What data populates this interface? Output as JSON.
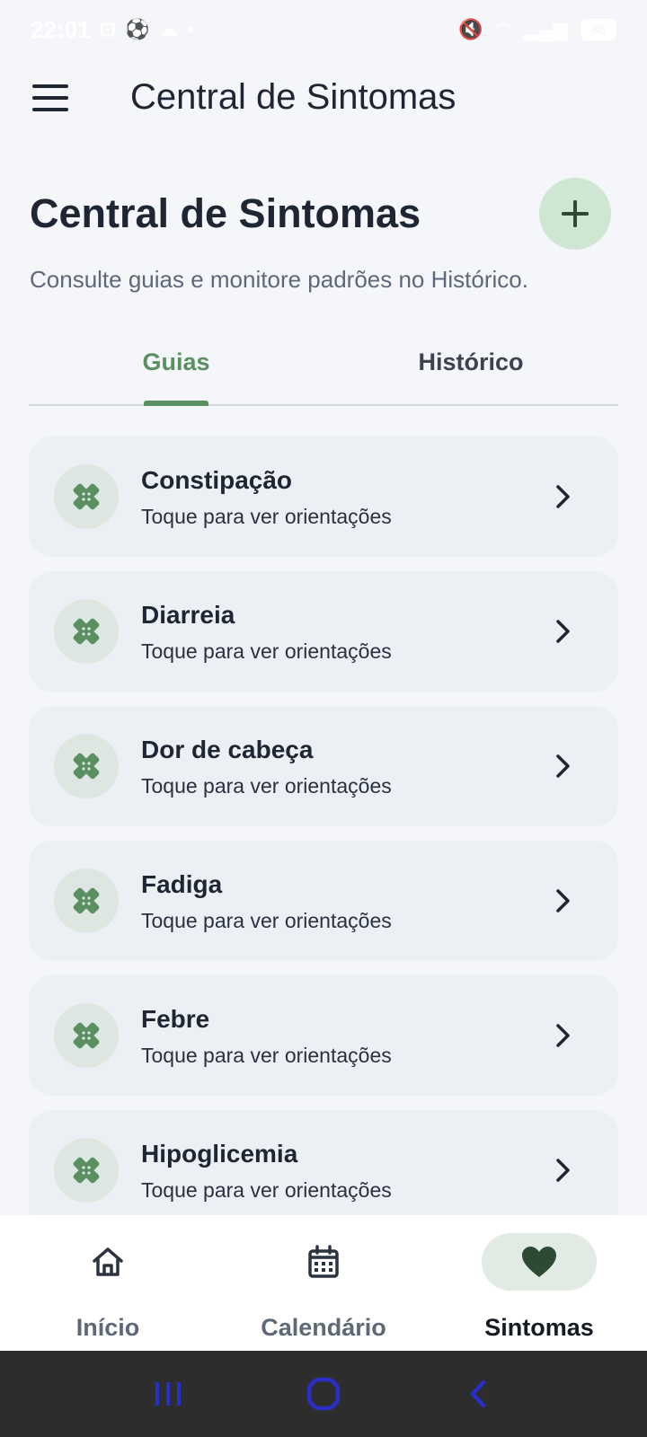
{
  "status_bar": {
    "time": "22:01",
    "battery": "88"
  },
  "app_bar": {
    "title": "Central de Sintomas"
  },
  "page": {
    "heading": "Central de Sintomas",
    "subtitle": "Consulte guias e monitore padrões no Histórico."
  },
  "tabs": [
    {
      "label": "Guias",
      "active": true
    },
    {
      "label": "Histórico",
      "active": false
    }
  ],
  "symptoms": [
    {
      "title": "Constipação",
      "subtitle": "Toque para ver orientações"
    },
    {
      "title": "Diarreia",
      "subtitle": "Toque para ver orientações"
    },
    {
      "title": "Dor de cabeça",
      "subtitle": "Toque para ver orientações"
    },
    {
      "title": "Fadiga",
      "subtitle": "Toque para ver orientações"
    },
    {
      "title": "Febre",
      "subtitle": "Toque para ver orientações"
    },
    {
      "title": "Hipoglicemia",
      "subtitle": "Toque para ver orientações"
    }
  ],
  "bottom_nav": [
    {
      "label": "Início",
      "icon": "home-icon",
      "active": false
    },
    {
      "label": "Calendário",
      "icon": "calendar-icon",
      "active": false
    },
    {
      "label": "Sintomas",
      "icon": "heart-icon",
      "active": true
    }
  ],
  "colors": {
    "accent": "#5a8f62",
    "fab_bg": "#cfe6d3",
    "card_bg": "#eceff3",
    "background": "#f4f6fa",
    "system_nav_icons": "#2a2fc8"
  }
}
